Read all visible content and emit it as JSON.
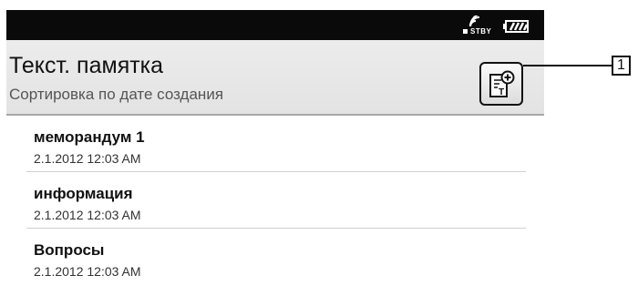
{
  "status": {
    "standby_label": "STBY",
    "standby_icon": "wireless-standby-icon",
    "battery_icon": "battery-icon"
  },
  "header": {
    "title": "Текст. памятка",
    "subtitle": "Сортировка по дате создания",
    "new_button_icon": "new-text-memo-icon"
  },
  "memos": [
    {
      "name": "меморандум 1",
      "date": "2.1.2012 12:03 AM"
    },
    {
      "name": "информация",
      "date": "2.1.2012 12:03 AM"
    },
    {
      "name": "Вопросы",
      "date": "2.1.2012 12:03 AM"
    }
  ],
  "callout": {
    "label": "1"
  },
  "colors": {
    "status_bar": "#0a0a0a",
    "header_bg": "#e6e6e6",
    "divider": "#cfcfcf"
  }
}
